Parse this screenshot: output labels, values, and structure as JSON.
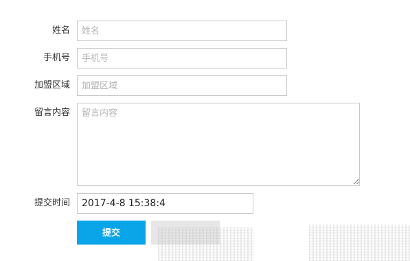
{
  "form": {
    "name": {
      "label": "姓名",
      "placeholder": "姓名",
      "value": ""
    },
    "phone": {
      "label": "手机号",
      "placeholder": "手机号",
      "value": ""
    },
    "region": {
      "label": "加盟区域",
      "placeholder": "加盟区域",
      "value": ""
    },
    "message": {
      "label": "留言内容",
      "placeholder": "留言内容",
      "value": ""
    },
    "time": {
      "label": "提交时间",
      "value": "2017-4-8 15:38:4"
    },
    "submit_label": "提交"
  },
  "colors": {
    "submit_background": "#0aa5e9",
    "field_border": "#c9c9c9",
    "reset_background": "#e6e6e6"
  }
}
